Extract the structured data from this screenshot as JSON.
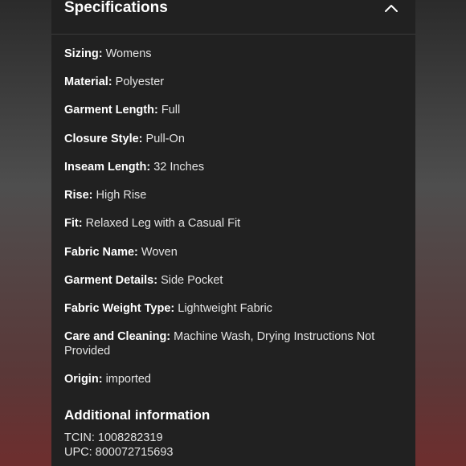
{
  "section": {
    "title": "Specifications",
    "toggle_icon": "chevron-up-icon"
  },
  "specs": [
    {
      "label": "Sizing:",
      "value": "Womens"
    },
    {
      "label": "Material:",
      "value": "Polyester"
    },
    {
      "label": "Garment Length:",
      "value": "Full"
    },
    {
      "label": "Closure Style:",
      "value": "Pull-On"
    },
    {
      "label": "Inseam Length:",
      "value": "32 Inches"
    },
    {
      "label": "Rise:",
      "value": "High Rise"
    },
    {
      "label": "Fit:",
      "value": "Relaxed Leg with a Casual Fit"
    },
    {
      "label": "Fabric Name:",
      "value": "Woven"
    },
    {
      "label": "Garment Details:",
      "value": "Side Pocket"
    },
    {
      "label": "Fabric Weight Type:",
      "value": "Lightweight Fabric"
    },
    {
      "label": "Care and Cleaning:",
      "value": "Machine Wash, Drying Instructions Not Provided"
    },
    {
      "label": "Origin:",
      "value": "imported"
    }
  ],
  "additional": {
    "title": "Additional information",
    "tcin": "TCIN: 1008282319",
    "upc": "UPC: 800072715693"
  },
  "colors": {
    "panel_bg": "#212121",
    "text": "#e4e4e4",
    "heading": "#ffffff",
    "side_glow": "#be3c3c"
  }
}
